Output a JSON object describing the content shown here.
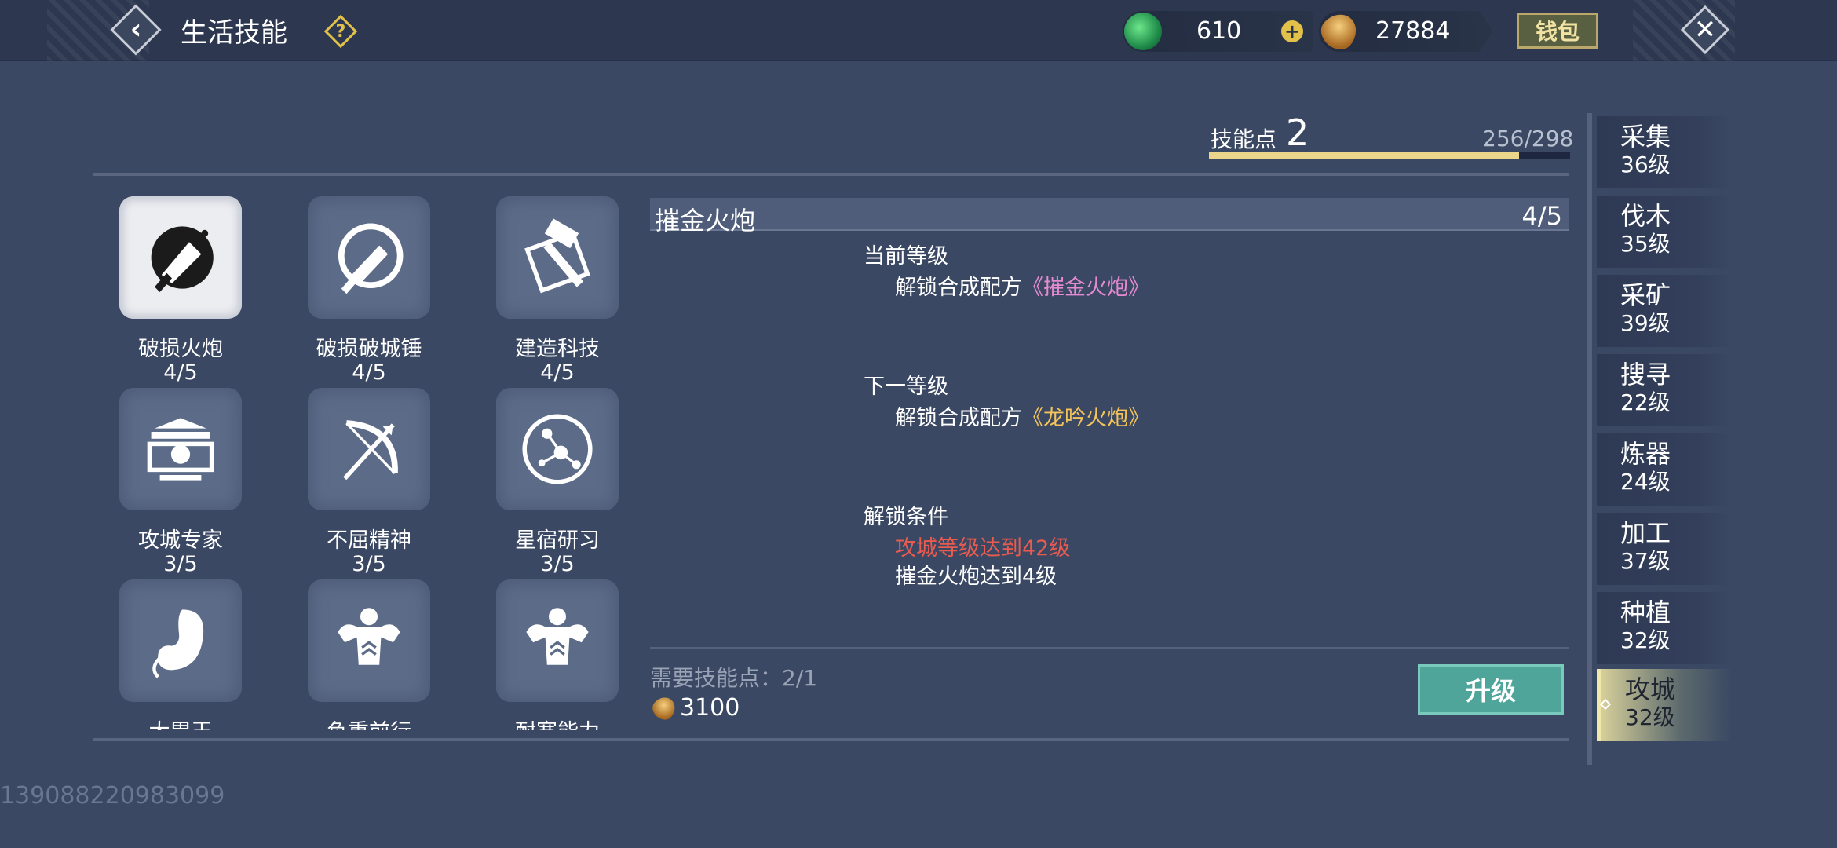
{
  "header": {
    "title": "生活技能",
    "help_label": "?",
    "jade_amount": "610",
    "gold_amount": "27884",
    "wallet_label": "钱包"
  },
  "skill_points": {
    "label": "技能点",
    "value": "2",
    "progress_text": "256/298",
    "progress_fraction": 0.859
  },
  "skills": [
    {
      "name": "破损火炮",
      "level": "4/5",
      "icon": "cannon-icon",
      "selected": true
    },
    {
      "name": "破损破城锤",
      "level": "4/5",
      "icon": "battering-ram-icon",
      "selected": false
    },
    {
      "name": "建造科技",
      "level": "4/5",
      "icon": "hammer-blueprint-icon",
      "selected": false
    },
    {
      "name": "攻城专家",
      "level": "3/5",
      "icon": "siege-expert-icon",
      "selected": false
    },
    {
      "name": "不屈精神",
      "level": "3/5",
      "icon": "bow-arrow-icon",
      "selected": false
    },
    {
      "name": "星宿研习",
      "level": "3/5",
      "icon": "constellation-icon",
      "selected": false
    },
    {
      "name": "大胃王",
      "level": "",
      "icon": "stomach-icon",
      "selected": false
    },
    {
      "name": "负重前行",
      "level": "",
      "icon": "muscle-icon",
      "selected": false
    },
    {
      "name": "耐寒能力",
      "level": "",
      "icon": "muscle-up-icon",
      "selected": false
    }
  ],
  "detail": {
    "title": "摧金火炮",
    "level": "4/5",
    "current_label": "当前等级",
    "current_prefix": "解锁合成配方",
    "current_item": "《摧金火炮》",
    "next_label": "下一等级",
    "next_prefix": "解锁合成配方",
    "next_item": "《龙吟火炮》",
    "unlock_label": "解锁条件",
    "unlock_cond_1": "攻城等级达到42级",
    "unlock_cond_2": "摧金火炮达到4级",
    "need_label": "需要技能点：",
    "need_value": "2/1",
    "cost_value": "3100",
    "upgrade_label": "升级"
  },
  "categories": [
    {
      "name": "采集",
      "level": "36级",
      "active": false
    },
    {
      "name": "伐木",
      "level": "35级",
      "active": false
    },
    {
      "name": "采矿",
      "level": "39级",
      "active": false
    },
    {
      "name": "搜寻",
      "level": "22级",
      "active": false
    },
    {
      "name": "炼器",
      "level": "24级",
      "active": false
    },
    {
      "name": "加工",
      "level": "37级",
      "active": false
    },
    {
      "name": "种植",
      "level": "32级",
      "active": false
    },
    {
      "name": "攻城",
      "level": "32级",
      "active": true
    }
  ],
  "uid": "139088220983099",
  "colors": {
    "background": "#3a4863",
    "accent_gold": "#f4c35a",
    "accent_pink": "#e58bd1",
    "warning_red": "#e85b4f",
    "upgrade_teal": "#4fa59a"
  }
}
